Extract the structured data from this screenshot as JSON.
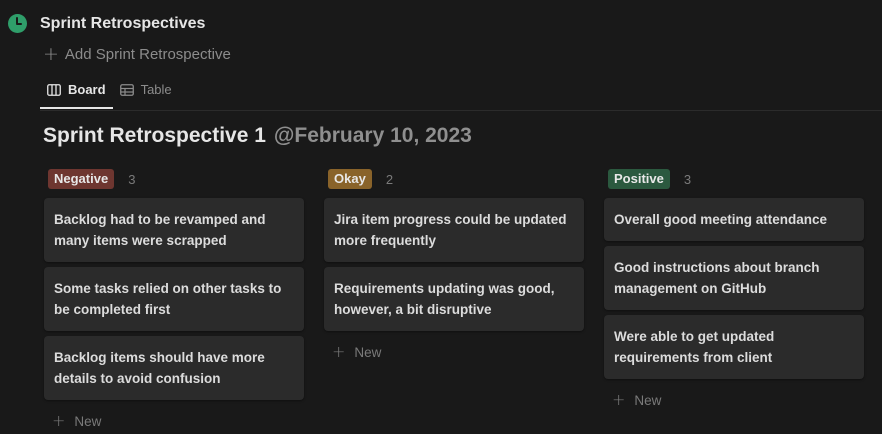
{
  "database": {
    "icon": "clock-icon",
    "icon_color": "#2f9e6a",
    "title": "Sprint Retrospectives",
    "add_label": "Add Sprint Retrospective"
  },
  "tabs": [
    {
      "label": "Board",
      "icon": "board-icon",
      "active": true
    },
    {
      "label": "Table",
      "icon": "table-icon",
      "active": false
    }
  ],
  "group": {
    "title": "Sprint Retrospective 1",
    "date": "@February 10, 2023"
  },
  "columns": [
    {
      "tag": "Negative",
      "tag_color": "#6e3630",
      "count": "3",
      "cards": [
        "Backlog had to be revamped and many items were scrapped",
        "Some tasks relied on other tasks to be completed first",
        "Backlog items should have more details to avoid confusion"
      ],
      "new_label": "New"
    },
    {
      "tag": "Okay",
      "tag_color": "#89632a",
      "count": "2",
      "cards": [
        "Jira item progress could be updated more frequently",
        "Requirements updating was good, however, a bit disruptive"
      ],
      "new_label": "New"
    },
    {
      "tag": "Positive",
      "tag_color": "#2b593f",
      "count": "3",
      "cards": [
        "Overall good meeting attendance",
        "Good instructions about branch management on GitHub",
        "Were able to get updated requirements from client"
      ],
      "new_label": "New"
    }
  ]
}
